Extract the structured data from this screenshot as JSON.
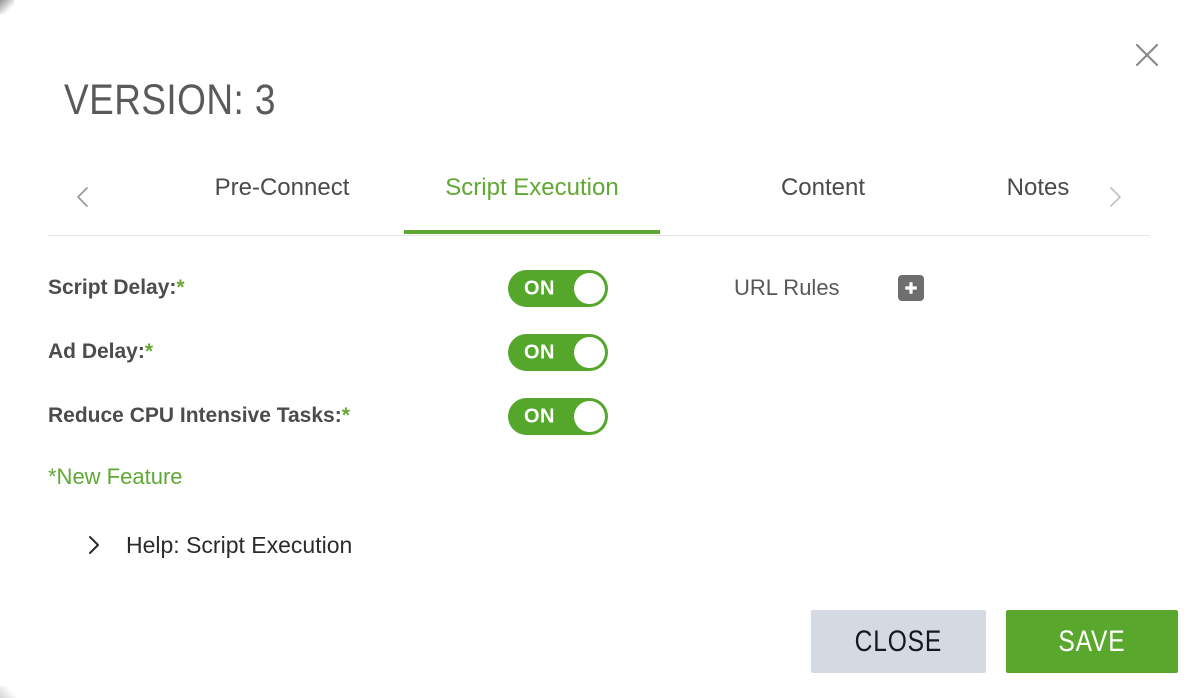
{
  "modal": {
    "title": "VERSION: 3",
    "close_icon": "close-x-icon"
  },
  "tabs": {
    "prev_arrow": "chevron-left-icon",
    "next_arrow": "chevron-right-icon",
    "items": [
      {
        "label": "Pre-Connect",
        "active": false
      },
      {
        "label": "Script Execution",
        "active": true
      },
      {
        "label": "Content",
        "active": false
      },
      {
        "label": "Notes",
        "active": false
      }
    ],
    "active_color": "#5fa833",
    "inactive_color": "#4a4a4a",
    "underline_color": "#5fa832"
  },
  "settings": {
    "rows": [
      {
        "label": "Script Delay:",
        "star": "*",
        "toggle_state": "ON"
      },
      {
        "label": "Ad Delay:",
        "star": "*",
        "toggle_state": "ON"
      },
      {
        "label": "Reduce CPU Intensive Tasks:",
        "star": "*",
        "toggle_state": "ON"
      }
    ],
    "toggle_on_color": "#55a72c"
  },
  "url_rules": {
    "label": "URL Rules",
    "add_icon": "plus-icon",
    "add_button_color": "#6e6e6e"
  },
  "notes": {
    "new_feature": "*New Feature",
    "new_feature_color": "#5fa833"
  },
  "help": {
    "chevron_icon": "chevron-right-icon",
    "label": "Help: Script Execution"
  },
  "footer": {
    "close_label": "CLOSE",
    "save_label": "SAVE",
    "close_color": "#d5d9e2",
    "save_color": "#5aa72e"
  }
}
